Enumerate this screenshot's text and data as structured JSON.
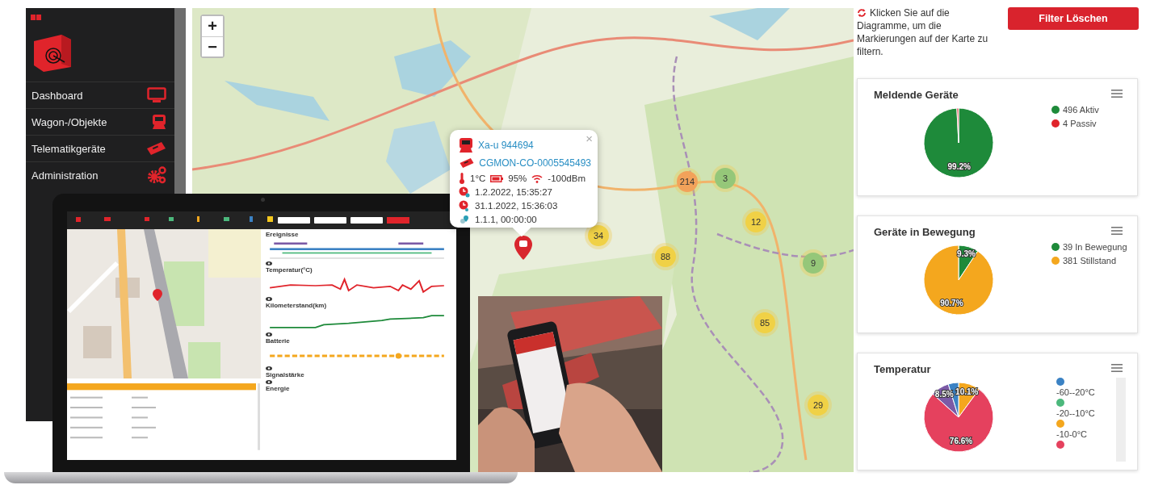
{
  "sidebar": {
    "items": [
      {
        "label": "Dashboard",
        "kind": "monitor"
      },
      {
        "label": "Wagon-/Objekte",
        "kind": "wagon"
      },
      {
        "label": "Telematikgeräte",
        "kind": "device"
      },
      {
        "label": "Administration",
        "kind": "gears"
      }
    ]
  },
  "map": {
    "zoom_buttons": [
      "+",
      "−"
    ],
    "popup": {
      "close": "×",
      "wagon": "Xa-u 944694",
      "device": "CGMON-CO-0005545493",
      "temperature": "1°C",
      "battery": "95%",
      "signal": "-100dBm",
      "times": [
        {
          "kind": "received",
          "text": "1.2.2022, 15:35:27"
        },
        {
          "kind": "sent",
          "text": "31.1.2022, 15:36:03"
        },
        {
          "kind": "position",
          "text": "1.1.1, 00:00:00"
        }
      ]
    },
    "clusters": [
      {
        "count": "214",
        "color": "#f2a25a"
      },
      {
        "count": "3",
        "color": "#95c779"
      },
      {
        "count": "12",
        "color": "#f0d146"
      },
      {
        "count": "34",
        "color": "#f0d146"
      },
      {
        "count": "88",
        "color": "#f0d146"
      },
      {
        "count": "9",
        "color": "#95c779"
      },
      {
        "count": "85",
        "color": "#f0d146"
      },
      {
        "count": "29",
        "color": "#f0d146"
      }
    ]
  },
  "laptop": {
    "chart_titles": [
      {
        "text": "Ereignisse",
        "kind": "dots"
      },
      {
        "text": "Temperatur(°C)",
        "kind": "temperature"
      },
      {
        "text": "Kilometerstand(km)",
        "kind": "mileage"
      },
      {
        "text": "Batterie",
        "kind": "battery"
      },
      {
        "text": "Signalstärke",
        "kind": "none"
      },
      {
        "text": "Energie",
        "kind": "none"
      }
    ]
  },
  "panel": {
    "hint": "Klicken Sie auf die Diagramme, um die Markierungen auf der Karte zu filtern.",
    "filter_button": "Filter Löschen",
    "charts": [
      {
        "title": "Meldende Geräte",
        "legend": [
          {
            "label": "496 Aktiv",
            "color": "#1e8a3a"
          },
          {
            "label": "4 Passiv",
            "color": "#e0242b"
          }
        ],
        "chart_data": {
          "type": "pie",
          "values": [
            99.2,
            0.8
          ],
          "colors": [
            "#1e8a3a",
            "#e0242b"
          ],
          "value_labels": [
            "99.2%",
            null
          ]
        }
      },
      {
        "title": "Geräte in Bewegung",
        "legend": [
          {
            "label": "39 In Bewegung",
            "color": "#1e8a3a"
          },
          {
            "label": "381 Stillstand",
            "color": "#f4a71e"
          }
        ],
        "chart_data": {
          "type": "pie",
          "values": [
            9.3,
            90.7
          ],
          "colors": [
            "#1e8a3a",
            "#f4a71e"
          ],
          "value_labels": [
            "9.3%",
            "90.7%"
          ]
        }
      },
      {
        "title": "Temperatur",
        "legend": [
          {
            "label": "-60--20°C",
            "color": "#3b82c4"
          },
          {
            "label": "-20--10°C",
            "color": "#4cb87c"
          },
          {
            "label": "-10-0°C",
            "color": "#f4a71e"
          },
          {
            "color": "#e5415e"
          }
        ],
        "chart_data": {
          "type": "pie",
          "values": [
            10.1,
            76.6,
            8.5,
            4.8
          ],
          "colors": [
            "#f4a71e",
            "#e5415e",
            "#7b5aa6",
            "#3b82c4"
          ],
          "value_labels": [
            "10.1%",
            "76.6%",
            "8.5%",
            null
          ]
        }
      }
    ]
  }
}
